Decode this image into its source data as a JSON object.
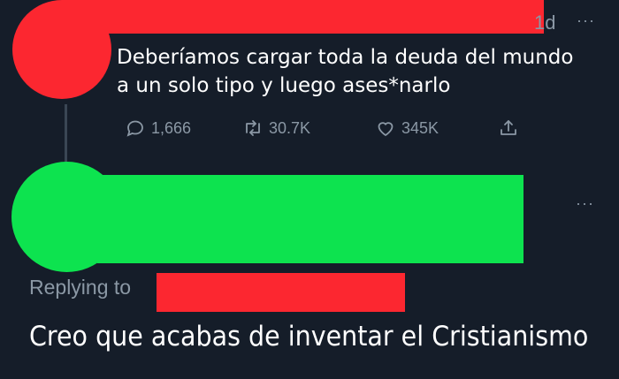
{
  "tweet": {
    "time": "1d",
    "more": "···",
    "text_line1": "Deberíamos cargar toda la deuda del mundo",
    "text_line2": "a un solo tipo y luego ases*narlo",
    "stats": {
      "replies": "1,666",
      "retweets": "30.7K",
      "likes": "345K"
    },
    "icons": [
      "reply-icon",
      "retweet-icon",
      "like-icon",
      "share-icon"
    ]
  },
  "reply": {
    "more": "···",
    "replying_to_label": "Replying to",
    "caption": "Creo que acabas de inventar el Cristianismo"
  },
  "colors": {
    "background": "#151d29",
    "redaction_red": "#fc2730",
    "redaction_green": "#0de34f",
    "muted_text": "#8b98a5"
  }
}
